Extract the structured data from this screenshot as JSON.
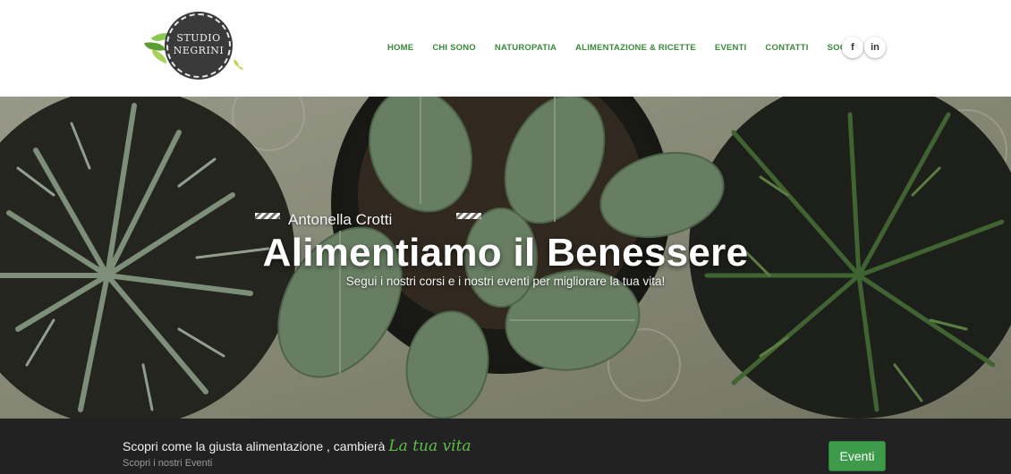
{
  "logo": {
    "line1": "STUDIO",
    "line2": "NEGRINI"
  },
  "nav": {
    "items": [
      {
        "label": "HOME"
      },
      {
        "label": "CHI SONO"
      },
      {
        "label": "NATUROPATIA"
      },
      {
        "label": "ALIMENTAZIONE & RICETTE"
      },
      {
        "label": "EVENTI"
      },
      {
        "label": "CONTATTI"
      },
      {
        "label": "SOCIAL"
      }
    ],
    "color": "#3a8a3a"
  },
  "social": {
    "facebook": "f",
    "linkedin": "in"
  },
  "hero": {
    "subtitle": "Antonella Crotti",
    "title": "Alimentiamo il Benessere",
    "description": "Segui i nostri corsi e i nostri eventi per migliorare la tua vita!"
  },
  "cta": {
    "text": "Scopri come la giusta alimentazione , cambierà",
    "accent": "La tua vita",
    "subtext": "Scopri i nostri Eventi",
    "button": "Eventi",
    "button_color": "#3d9a4a",
    "accent_color": "#5fbf4a"
  }
}
